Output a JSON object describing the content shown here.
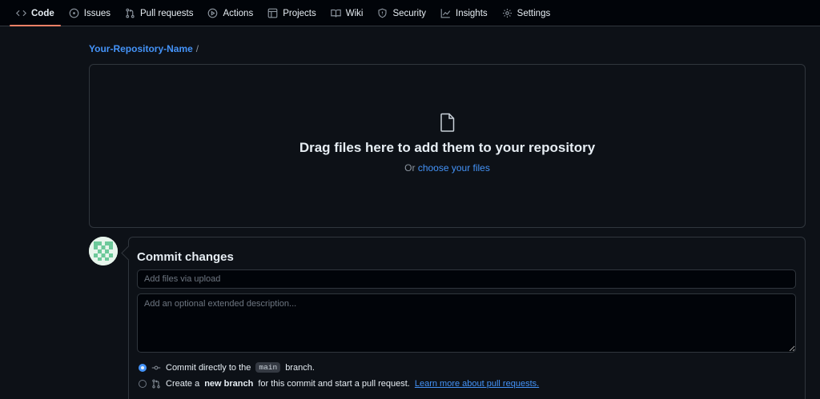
{
  "nav": {
    "items": [
      {
        "label": "Code",
        "icon": "code-icon",
        "active": true
      },
      {
        "label": "Issues",
        "icon": "issue-icon"
      },
      {
        "label": "Pull requests",
        "icon": "pull-request-icon"
      },
      {
        "label": "Actions",
        "icon": "play-icon"
      },
      {
        "label": "Projects",
        "icon": "table-icon"
      },
      {
        "label": "Wiki",
        "icon": "book-icon"
      },
      {
        "label": "Security",
        "icon": "shield-icon"
      },
      {
        "label": "Insights",
        "icon": "graph-icon"
      },
      {
        "label": "Settings",
        "icon": "gear-icon"
      }
    ],
    "active_underline_color": "#f78166"
  },
  "breadcrumb": {
    "repo": "Your-Repository-Name",
    "separator": "/"
  },
  "dropzone": {
    "title": "Drag files here to add them to your repository",
    "or_text": "Or",
    "choose_link": "choose your files"
  },
  "commit": {
    "title": "Commit changes",
    "summary_placeholder": "Add files via upload",
    "description_placeholder": "Add an optional extended description...",
    "option_direct": {
      "prefix": "Commit directly to the",
      "branch": "main",
      "suffix": "branch.",
      "checked": true
    },
    "option_new_branch": {
      "prefix": "Create a",
      "bold": "new branch",
      "middle": "for this commit and start a pull request.",
      "link": "Learn more about pull requests.",
      "checked": false
    }
  },
  "colors": {
    "background": "#0d1117",
    "link": "#4493f8",
    "border": "#30363d"
  }
}
